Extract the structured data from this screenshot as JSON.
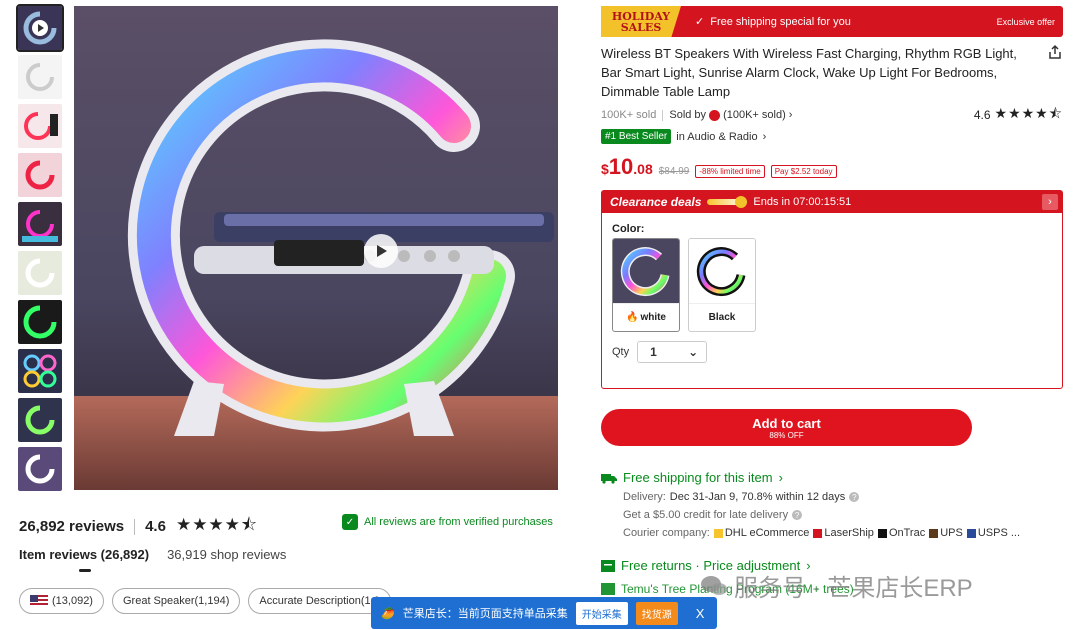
{
  "gallery": {
    "thumbnail_count": 10
  },
  "reviews": {
    "count_label": "26,892 reviews",
    "rating": "4.6",
    "stars": "★★★★⯪",
    "verified": "All reviews are from verified purchases",
    "tab_item": "Item reviews (26,892)",
    "tab_shop": "36,919 shop reviews",
    "chips": [
      "(13,092)",
      "Great Speaker(1,194)",
      "Accurate Description(1,0"
    ]
  },
  "banner": {
    "holiday_line1": "HOLIDAY",
    "holiday_line2": "SALES",
    "free_shipping": "Free shipping special for you",
    "exclusive": "Exclusive offer"
  },
  "product": {
    "title": "Wireless BT Speakers With Wireless Fast Charging, Rhythm RGB Light, Bar Smart Light, Sunrise Alarm Clock, Wake Up Light For Bedrooms, Dimmable Table Lamp",
    "sold": "100K+ sold",
    "sold_by_label": "Sold by",
    "seller_sold": "(100K+ sold)",
    "rating": "4.6",
    "stars": "★★★★⯪",
    "best_badge": "#1 Best Seller",
    "best_category": "in Audio & Radio",
    "price_currency": "$",
    "price_int": "10",
    "price_dec": ".08",
    "price_old": "$84.99",
    "discount_tag": "-88% limited time",
    "pay_tag": "Pay $2.52 today"
  },
  "clearance": {
    "title": "Clearance deals",
    "ends": "Ends in 07:00:15:51",
    "color_label": "Color:",
    "swatches": [
      {
        "label": "white"
      },
      {
        "label": "Black"
      }
    ],
    "qty_label": "Qty",
    "qty_value": "1"
  },
  "cart": {
    "label": "Add to cart",
    "sub": "88% OFF"
  },
  "shipping": {
    "title": "Free shipping for this item",
    "delivery": "Delivery:",
    "delivery_value": "Dec 31-Jan 9, 70.8% within 12 days",
    "credit": "Get a $5.00 credit for late delivery",
    "courier_label": "Courier company:",
    "couriers": [
      "DHL eCommerce",
      "LaserShip",
      "OnTrac",
      "UPS",
      "USPS ..."
    ],
    "returns": "Free returns · Price adjustment",
    "tree": "Temu's Tree Planting Program (16M+ trees)"
  },
  "watermark": "服务号 · 芒果店长ERP",
  "collector": {
    "text": "芒果店长：当前页面支持单品采集",
    "btn_collect": "开始采集",
    "btn_source": "找货源",
    "close": "X"
  }
}
